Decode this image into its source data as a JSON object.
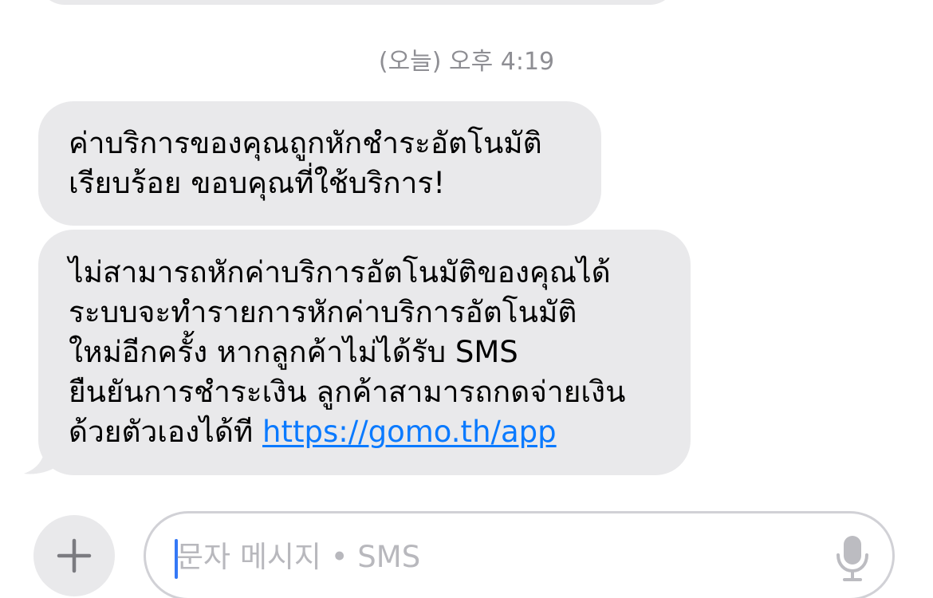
{
  "conversation": {
    "timestamp": "(오늘) 오후 4:19",
    "messages": [
      {
        "lines": [
          "ค่าบริการของคุณถูกหักชำระอัตโนมัติ",
          "เรียบร้อย ขอบคุณที่ใช้บริการ!"
        ]
      },
      {
        "lines": [
          "ไม่สามารถหักค่าบริการอัตโนมัติของคุณได้",
          "ระบบจะทำรายการหักค่าบริการอัตโนมัติ",
          "ใหม่อีกครั้ง หากลูกค้าไม่ได้รับ SMS",
          "ยืนยันการชำระเงิน ลูกค้าสามารถกดจ่ายเงิน",
          "ด้วยตัวเองได้ที"
        ],
        "link": "https://gomo.th/app"
      }
    ]
  },
  "composer": {
    "placeholder": "문자 메시지 • SMS",
    "add_icon": "plus-icon",
    "mic_icon": "microphone-icon"
  },
  "colors": {
    "bubble": "#e9e9eb",
    "link": "#0a7aff",
    "timestamp": "#8e8e93",
    "caret": "#3478f6"
  }
}
